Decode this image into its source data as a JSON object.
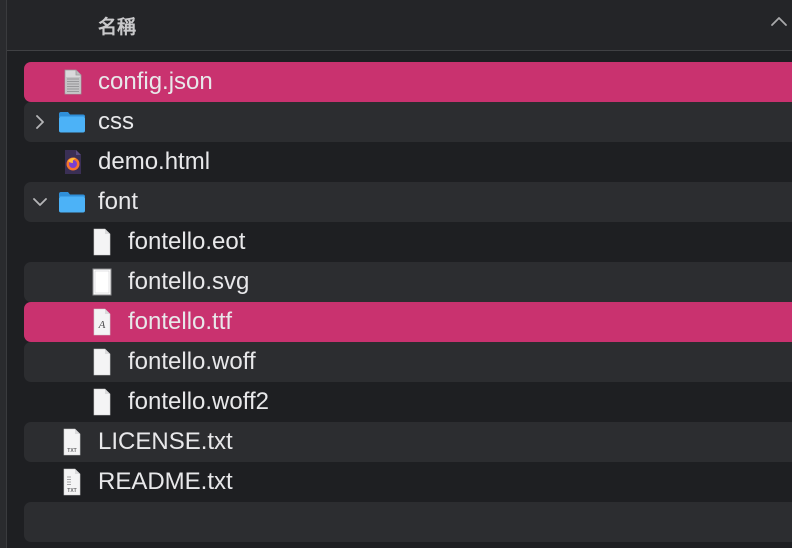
{
  "header": {
    "name_column": "名稱"
  },
  "rows": [
    {
      "label": "config.json",
      "icon": "json-file-icon",
      "level": 0,
      "selected": true
    },
    {
      "label": "css",
      "icon": "folder-icon",
      "level": 0,
      "expandable": true,
      "expanded": false
    },
    {
      "label": "demo.html",
      "icon": "firefox-html-file-icon",
      "level": 0
    },
    {
      "label": "font",
      "icon": "folder-icon",
      "level": 0,
      "expandable": true,
      "expanded": true
    },
    {
      "label": "fontello.eot",
      "icon": "document-icon",
      "level": 1
    },
    {
      "label": "fontello.svg",
      "icon": "svg-file-icon",
      "level": 1
    },
    {
      "label": "fontello.ttf",
      "icon": "font-file-icon",
      "level": 1,
      "selected": true
    },
    {
      "label": "fontello.woff",
      "icon": "document-icon",
      "level": 1
    },
    {
      "label": "fontello.woff2",
      "icon": "document-icon",
      "level": 1
    },
    {
      "label": "LICENSE.txt",
      "icon": "txt-file-icon",
      "level": 0
    },
    {
      "label": "README.txt",
      "icon": "txt-file-icon",
      "level": 0
    }
  ],
  "icon_labels": {
    "txt": "TXT",
    "font_glyph": "A"
  },
  "colors": {
    "selection": "#c9326f",
    "folder": "#3fa9f5",
    "row_alt": "#2c2d30",
    "background": "#1e1f22"
  }
}
